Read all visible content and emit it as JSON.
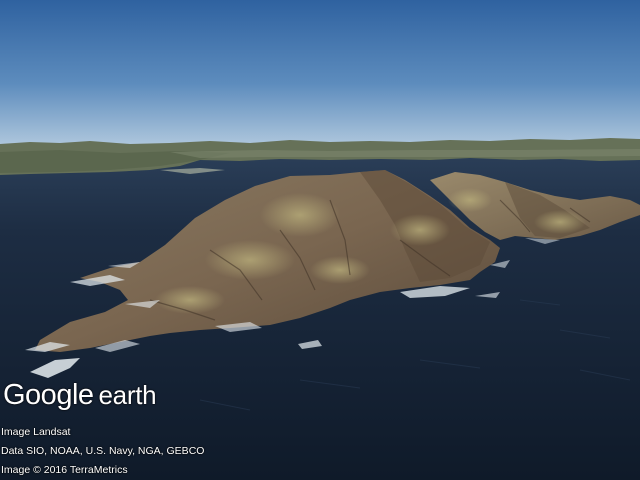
{
  "branding": {
    "logo_google": "Google",
    "logo_earth": "earth"
  },
  "attribution": {
    "imagery": "Image Landsat",
    "data_sources": "Data SIO, NOAA, U.S. Navy, NGA, GEBCO",
    "copyright": "Image © 2016 TerraMetrics"
  },
  "colors": {
    "sky_top": "#3c6fa8",
    "sky_horizon": "#b9cfe0",
    "ocean": "#17263a",
    "coast_land": "#6f7a62",
    "island_rock": "#7a6a55",
    "surf_foam": "#e8eef2"
  }
}
